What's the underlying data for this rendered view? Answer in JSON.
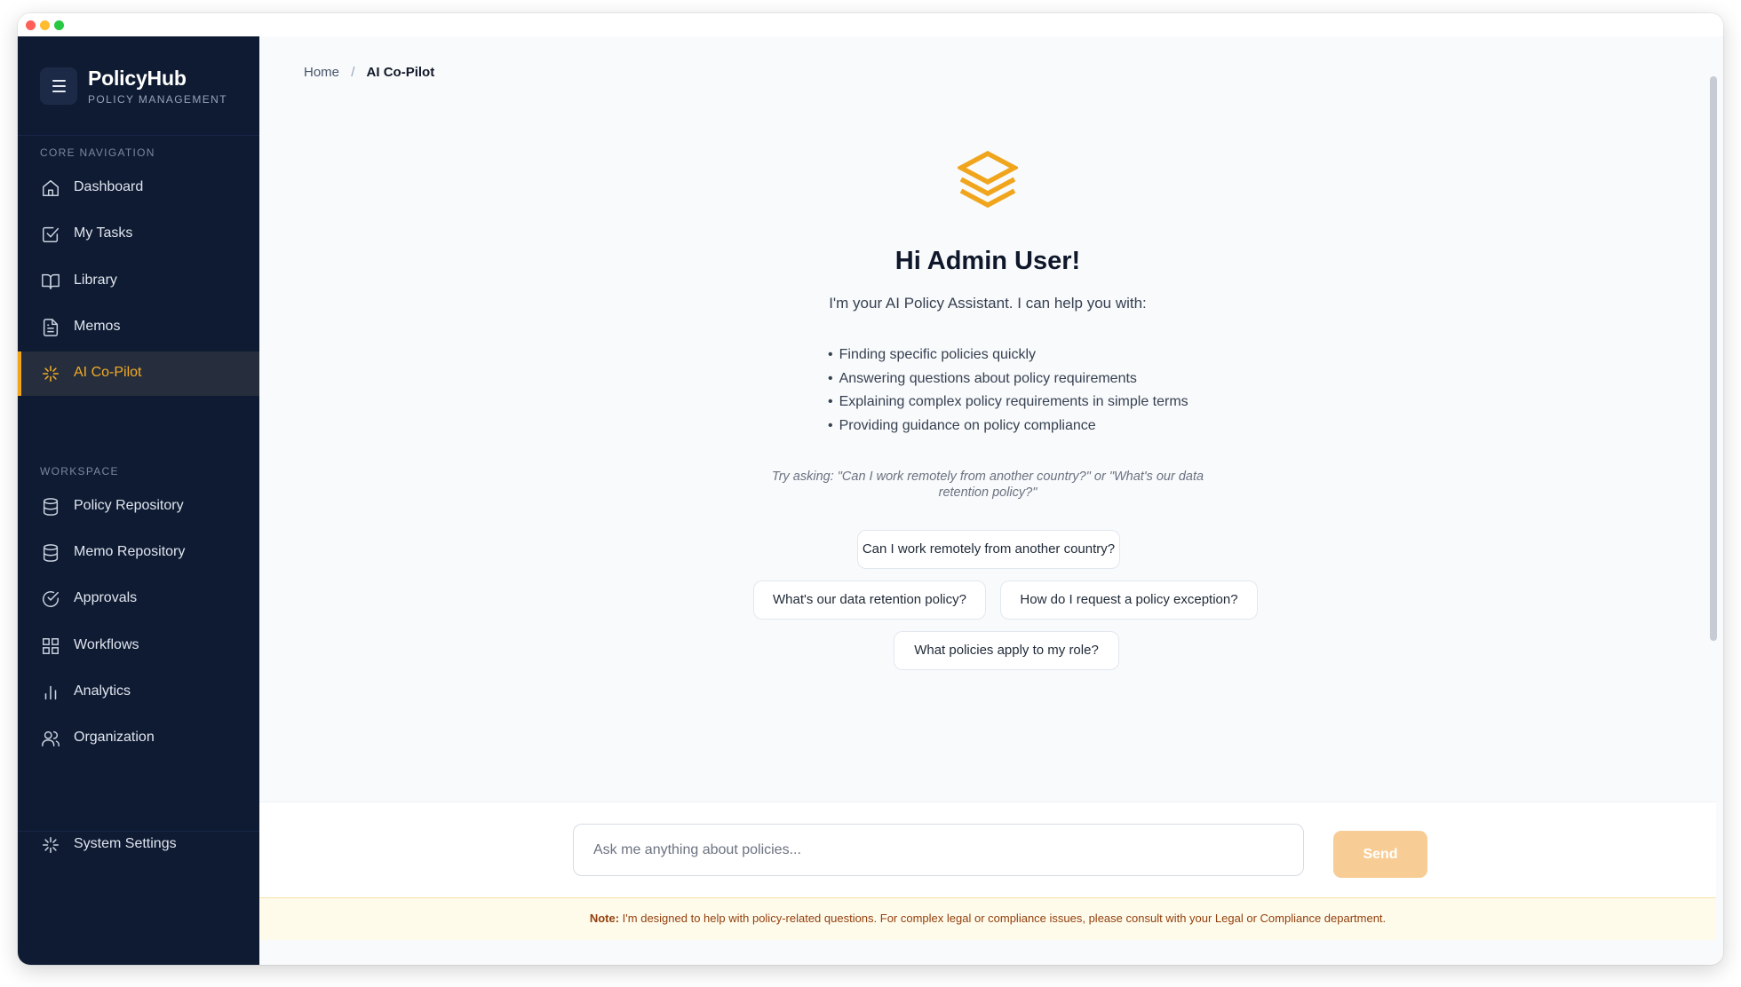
{
  "app": {
    "name": "PolicyHub",
    "subtitle": "POLICY MANAGEMENT"
  },
  "sidebar": {
    "core_label": "CORE NAVIGATION",
    "core_items": [
      {
        "label": "Dashboard",
        "icon": "home-icon"
      },
      {
        "label": "My Tasks",
        "icon": "checkbox-icon"
      },
      {
        "label": "Library",
        "icon": "book-icon"
      },
      {
        "label": "Memos",
        "icon": "document-icon"
      },
      {
        "label": "AI Co-Pilot",
        "icon": "sparkle-icon",
        "active": true
      }
    ],
    "workspace_label": "WORKSPACE",
    "workspace_items": [
      {
        "label": "Policy Repository",
        "icon": "database-icon"
      },
      {
        "label": "Memo Repository",
        "icon": "database-icon"
      },
      {
        "label": "Approvals",
        "icon": "check-circle-icon"
      },
      {
        "label": "Workflows",
        "icon": "grid-icon"
      },
      {
        "label": "Analytics",
        "icon": "bar-chart-icon"
      },
      {
        "label": "Organization",
        "icon": "users-icon"
      }
    ],
    "settings_label": "System Settings"
  },
  "breadcrumb": {
    "home": "Home",
    "separator": "/",
    "current": "AI Co-Pilot"
  },
  "welcome": {
    "greeting": "Hi Admin User!",
    "intro": "I'm your AI Policy Assistant. I can help you with:",
    "capabilities": [
      "Finding specific policies quickly",
      "Answering questions about policy requirements",
      "Explaining complex policy requirements in simple terms",
      "Providing guidance on policy compliance"
    ],
    "hint_line1": "Try asking: \"Can I work remotely from another country?\" or \"What's our data",
    "hint_line2": "retention policy?\""
  },
  "suggestions": [
    "Can I work remotely from another country?",
    "What's our data retention policy?",
    "How do I request a policy exception?",
    "What policies apply to my role?"
  ],
  "composer": {
    "placeholder": "Ask me anything about policies...",
    "value": "",
    "send_label": "Send"
  },
  "note": {
    "prefix": "Note:",
    "text": " I'm designed to help with policy-related questions. For complex legal or compliance issues, please consult with your Legal or Compliance department."
  },
  "colors": {
    "sidebar_bg": "#0f1b33",
    "accent": "#f0a51d",
    "send_bg": "#f7cd95",
    "note_bg": "#fffbeb",
    "note_text": "#92400e"
  }
}
